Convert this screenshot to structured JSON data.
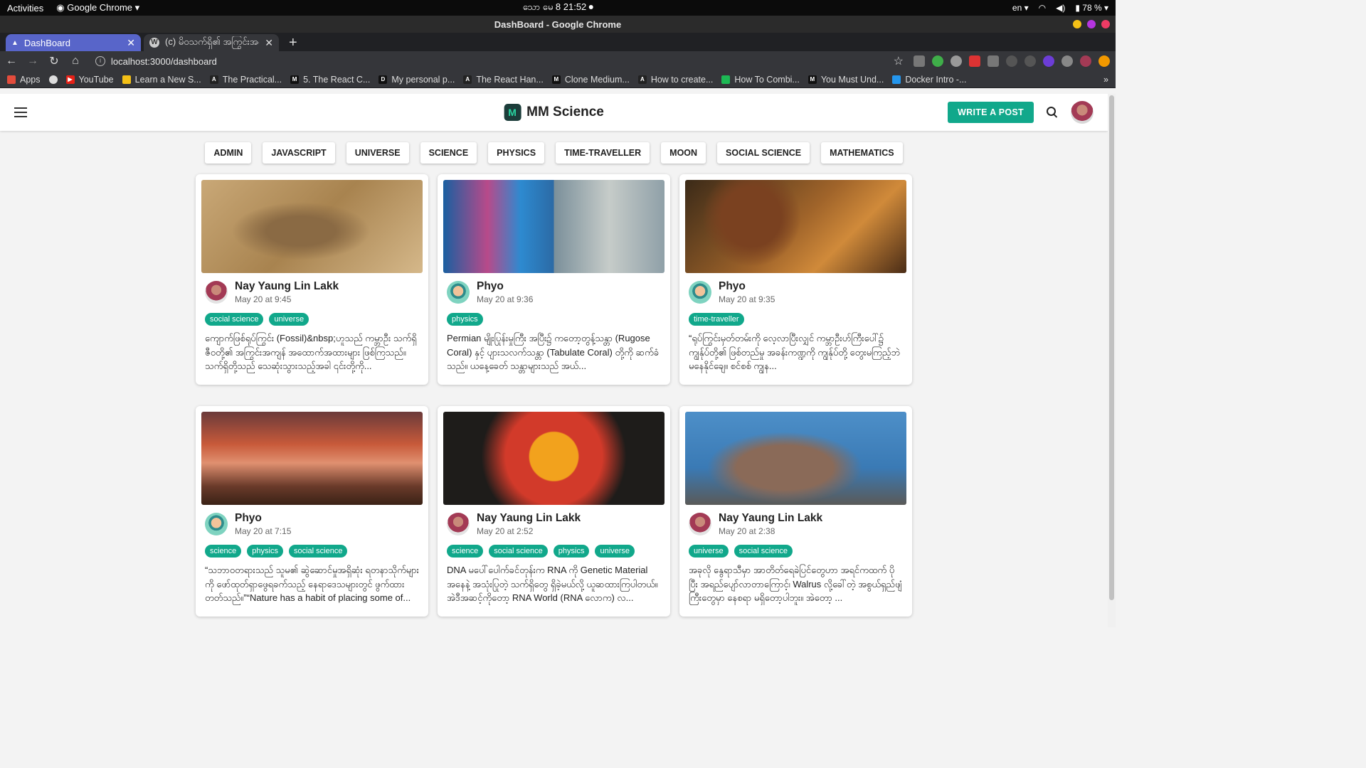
{
  "os_bar": {
    "activities": "Activities",
    "app": "Google Chrome",
    "clock": "သော မေ 8  21:52",
    "lang": "en",
    "battery": "78 %"
  },
  "window": {
    "title": "DashBoard - Google Chrome"
  },
  "tabs": [
    {
      "title": "DashBoard"
    },
    {
      "title": "(c) မိဝသက်ရှိ၏ အကြွင်းအကျ"
    }
  ],
  "url": "localhost:3000/dashboard",
  "bookmarks": [
    "Apps",
    "YouTube",
    "Learn a New S...",
    "The Practical...",
    "5. The React C...",
    "My personal p...",
    "The React Han...",
    "Clone Medium...",
    "How to create...",
    "How To Combi...",
    "You Must Und...",
    "Docker Intro -..."
  ],
  "app": {
    "brand": "MM Science",
    "write_button": "WRITE A POST",
    "categories": [
      "ADMIN",
      "JAVASCRIPT",
      "UNIVERSE",
      "SCIENCE",
      "PHYSICS",
      "TIME-TRAVELLER",
      "MOON",
      "SOCIAL SCIENCE",
      "MATHEMATICS"
    ]
  },
  "posts": [
    {
      "author": "Nay Yaung Lin Lakk",
      "date": "May 20 at 9:45",
      "tags": [
        "social science",
        "universe"
      ],
      "excerpt": "ကျောက်ဖြစ်ရုပ်ကြွင်း (Fossil)&nbsp;ဟူသည် ကမ္ဘာဦး သက်ရှိဇီဝတို့၏ အကြွင်းအကျန် အထောက်အထားများ ဖြစ်ကြသည်။ သက်ရှိတို့သည် သေဆုံးသွားသည့်အခါ ၎င်းတို့ကို..."
    },
    {
      "author": "Phyo",
      "date": "May 20 at 9:36",
      "tags": [
        "physics"
      ],
      "excerpt": "Permian မျိုးပြုန်းမှုကြီး အပြီး၌ ကတော့တွန့်သန္တာ (Rugose Coral) နှင့် ပျားသလက်သန္တာ (Tabulate Coral) တို့ကို ဆက်ခံသည်။ ယနေ့ခေတ် သန္တာများသည် အယ်..."
    },
    {
      "author": "Phyo",
      "date": "May 20 at 9:35",
      "tags": [
        "time-traveller"
      ],
      "excerpt": "“ရုပ်ကြွင်းမှတ်တမ်းကို လေ့လာပြီးလျှင် ကမ္ဘာဦးဟ်ကြီးပေါ်၌ ကျွန်ုပ်တို့၏ ဖြစ်တည်မှု အခန်းကဏ္ဍကို ကျွန်ုပ်တို့ တွေးမကြည့်ဘဲ မနေနိုင်ချေ။ စင်စစ် ကျွန..."
    },
    {
      "author": "Phyo",
      "date": "May 20 at 7:15",
      "tags": [
        "science",
        "physics",
        "social science"
      ],
      "excerpt": "“သဘာဝတရားသည် သူမ၏ ဆွဲဆောင်မှုအရှိဆုံး ရတနာသိုက်များကို ဖော်ထုတ်ရှာဖွေရခက်သည့် နေရာဒေသများတွင် ဖွက်ထားတတ်သည်။”“Nature has a habit of placing some of..."
    },
    {
      "author": "Nay Yaung Lin Lakk",
      "date": "May 20 at 2:52",
      "tags": [
        "science",
        "social science",
        "physics",
        "universe"
      ],
      "excerpt": "DNA မပေါ်ပေါက်ခင်တုန်းက RNA ကို Genetic Material အနေနဲ့ အသုံးပြုတဲ့ သက်ရှိတွေ ရှိခဲ့မယ်လို့ ယူဆထားကြပါတယ်။ အဲဒီအဆင့်ကိုတော့ RNA World (RNA လောက) လ..."
    },
    {
      "author": "Nay Yaung Lin Lakk",
      "date": "May 20 at 2:38",
      "tags": [
        "universe",
        "social science"
      ],
      "excerpt": "အခုလို နွေရာသီမှာ အာတိတ်ရေခဲပြင်တွေဟာ အရင်ကထက် ပိုပြီး အရည်ပျော်လာတာကြောင့်၊ Walrus လို့ခေါ်တဲ့ အစွယ်ရှည်ဖျံကြီးတွေမှာ နေစရာ မရှိတော့ပါဘူး။ အဲတော့ ..."
    }
  ]
}
